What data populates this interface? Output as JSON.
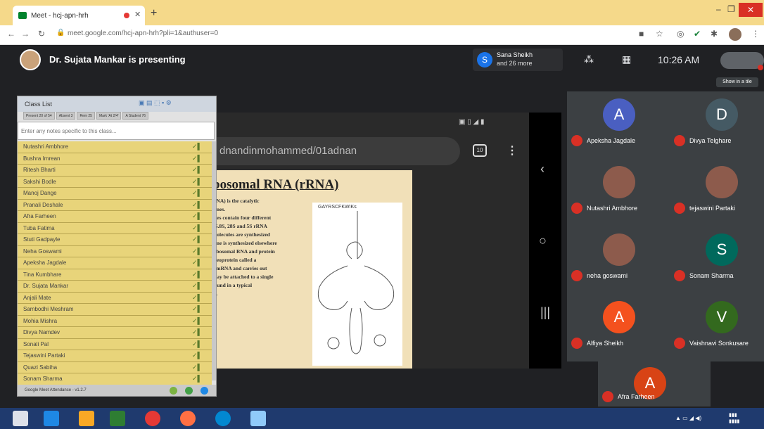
{
  "browser": {
    "tab_title": "Meet - hcj-apn-hrh",
    "url": "meet.google.com/hcj-apn-hrh?pli=1&authuser=0"
  },
  "meet": {
    "presenting_text": "Dr. Sujata Mankar is presenting",
    "chip_line1": "Sana Sheikh",
    "chip_line2": "and 26 more",
    "time": "10:26 AM",
    "show_tip": "Show in a tile"
  },
  "phone": {
    "url_text": "dnandinmohammed/01adnan",
    "tab_count": "10"
  },
  "slide": {
    "title": "bosomal RNA (rRNA)",
    "lines": [
      "RNA) is the catalytic",
      "omes.",
      "mes contain four different",
      ", 5.8S, 28S and 5S rRNA",
      "molecules are synthesized",
      "ome is synthesized elsewhere",
      "ribosomal RNA and protein",
      "oleoprotein called a",
      "",
      "e mRNA and carries out",
      "",
      "may be attached to a single",
      "",
      "found in a typical",
      "A."
    ],
    "rna_label": "GAYRSCFKWIKs"
  },
  "class_list": {
    "title": "Class List",
    "tabs": [
      "Present 20 of 54",
      "Absent 3",
      "Rem 25",
      "Mark 'At 2/4'",
      "A Student 76"
    ],
    "notes_placeholder": "Enter any notes specific to this class...",
    "students": [
      "Nutashri Ambhore",
      "Bushra Imrean",
      "Ritesh Bharti",
      "Sakshi Bodle",
      "Manoj Dange",
      "Pranali Deshale",
      "Afra Farheen",
      "Tuba Fatima",
      "Stuti Gadpayle",
      "Neha Goswami",
      "Apeksha Jagdale",
      "Tina Kumbhare",
      "Dr. Sujata Mankar",
      "Anjali Mate",
      "Sambodhi Meshram",
      "Mohia Mishra",
      "Divya Namdev",
      "Sonali Pal",
      "Tejaswini Partaki",
      "Quazi Sabiha",
      "Sonam Sharma"
    ],
    "footer": "Google Meet Attendance - v1.2.7"
  },
  "participants": [
    {
      "name": "Apeksha Jagdale",
      "initial": "A",
      "color": "#4a5fc1",
      "photo": false
    },
    {
      "name": "Divya Telghare",
      "initial": "D",
      "color": "#455a64",
      "photo": false
    },
    {
      "name": "Nutashri Ambhore",
      "initial": "",
      "color": "",
      "photo": true
    },
    {
      "name": "tejaswini Partaki",
      "initial": "",
      "color": "",
      "photo": true
    },
    {
      "name": "neha goswami",
      "initial": "",
      "color": "",
      "photo": true
    },
    {
      "name": "Sonam Sharma",
      "initial": "S",
      "color": "#00695c",
      "photo": false
    },
    {
      "name": "Alfiya Sheikh",
      "initial": "A",
      "color": "#f4511e",
      "photo": false
    },
    {
      "name": "Vaishnavi Sonkusare",
      "initial": "V",
      "color": "#33691e",
      "photo": false
    },
    {
      "name": "Afra Farheen",
      "initial": "A",
      "color": "#d84315",
      "photo": false
    }
  ]
}
